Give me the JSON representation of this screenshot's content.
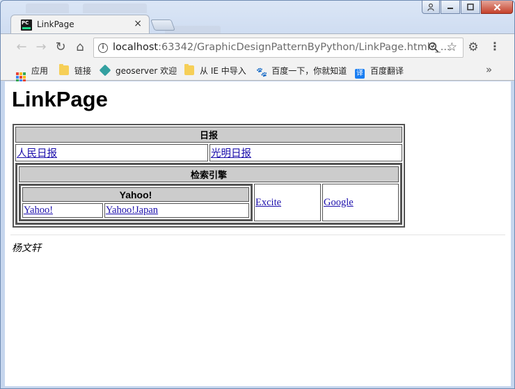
{
  "tab": {
    "title": "LinkPage",
    "close": "×"
  },
  "toolbar": {
    "back": "←",
    "forward": "→",
    "reload": "↻",
    "home": "⌂",
    "url_host": "localhost",
    "url_rest": ":63342/GraphicDesignPatternByPython/LinkPage.html?_...",
    "zoom_icon": "search-minus-icon",
    "star_icon": "star-icon"
  },
  "bookmarks": [
    {
      "label": "应用",
      "icon": "apps-icon"
    },
    {
      "label": "链接",
      "icon": "folder-icon"
    },
    {
      "label": "geoserver 欢迎",
      "icon": "geoserver-icon"
    },
    {
      "label": "从 IE 中导入",
      "icon": "folder-icon"
    },
    {
      "label": "百度一下，你就知道",
      "icon": "baidu-paw-icon"
    },
    {
      "label": "百度翻译",
      "icon": "baidu-translate-icon"
    }
  ],
  "bookmarks_overflow": "»",
  "page": {
    "title": "LinkPage",
    "newspaper": {
      "caption": "日报",
      "links": [
        "人民日报",
        "光明日报"
      ]
    },
    "search": {
      "caption": "检索引擎",
      "yahoo": {
        "caption": "Yahoo!",
        "links": [
          "Yahoo!",
          "Yahoo!Japan"
        ]
      },
      "links": [
        "Excite",
        "Google"
      ]
    },
    "author": "杨文轩"
  },
  "colors": {
    "header_bg": "#cccccc",
    "link": "#1a0dab",
    "close_button": "#c5412b"
  }
}
